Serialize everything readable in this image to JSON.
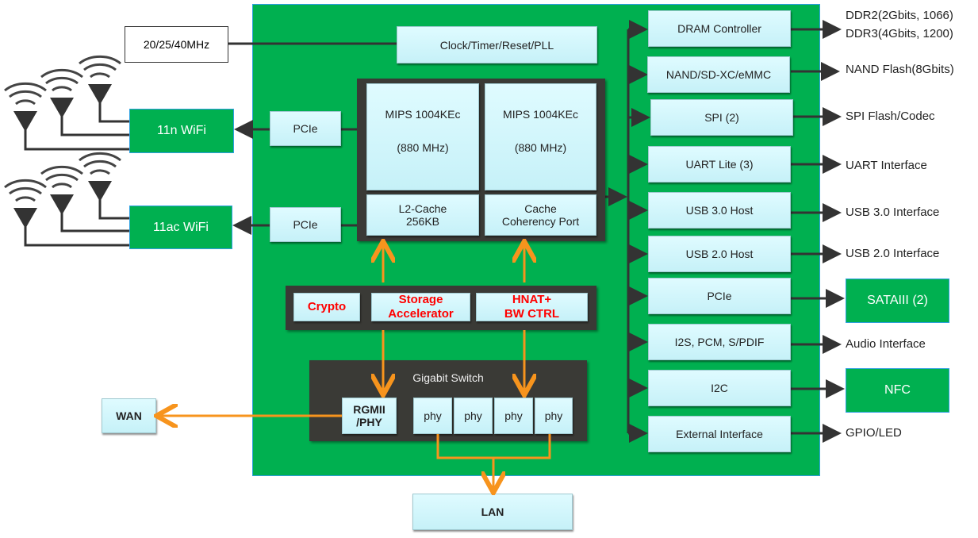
{
  "oscillator": "20/25/40MHz",
  "clock": "Clock/Timer/Reset/PLL",
  "cpu": {
    "core1_name": "MIPS 1004KEc",
    "core1_freq": "(880 MHz)",
    "core2_name": "MIPS 1004KEc",
    "core2_freq": "(880 MHz)",
    "l2_line1": "L2-Cache",
    "l2_line2": "256KB",
    "ccp_line1": "Cache",
    "ccp_line2": "Coherency Port"
  },
  "wifi": {
    "n_label": "11n WiFi",
    "ac_label": "11ac WiFi",
    "pcie1": "PCIe",
    "pcie2": "PCIe"
  },
  "accel": {
    "crypto": "Crypto",
    "storage1": "Storage",
    "storage2": "Accelerator",
    "hnat1": "HNAT+",
    "hnat2": "BW CTRL"
  },
  "switch": {
    "title": "Gigabit Switch",
    "rgmii1": "RGMII",
    "rgmii2": "/PHY",
    "phys": [
      "phy",
      "phy",
      "phy",
      "phy"
    ]
  },
  "wan": "WAN",
  "lan": "LAN",
  "peripherals": [
    {
      "block": "DRAM Controller",
      "ext": [
        "DDR2(2Gbits, 1066)",
        "DDR3(4Gbits, 1200)"
      ]
    },
    {
      "block": "NAND/SD-XC/eMMC",
      "ext": [
        "NAND Flash(8Gbits)"
      ]
    },
    {
      "block": "SPI (2)",
      "ext": [
        "SPI Flash/Codec"
      ]
    },
    {
      "block": "UART Lite (3)",
      "ext": [
        "UART Interface"
      ]
    },
    {
      "block": "USB 3.0 Host",
      "ext": [
        "USB 3.0 Interface"
      ]
    },
    {
      "block": "USB 2.0 Host",
      "ext": [
        "USB 2.0 Interface"
      ]
    },
    {
      "block": "PCIe",
      "ext": [
        "SATAIII (2)"
      ]
    },
    {
      "block": "I2S, PCM, S/PDIF",
      "ext": [
        "Audio Interface"
      ]
    },
    {
      "block": "I2C",
      "ext": [
        "NFC"
      ]
    },
    {
      "block": "External Interface",
      "ext": [
        "GPIO/LED"
      ]
    }
  ],
  "colors": {
    "chip": "#00b050",
    "block": "#ccf5fb",
    "dark": "#3a3a36",
    "orange": "#f7941d",
    "accel_text": "#ff0000"
  }
}
